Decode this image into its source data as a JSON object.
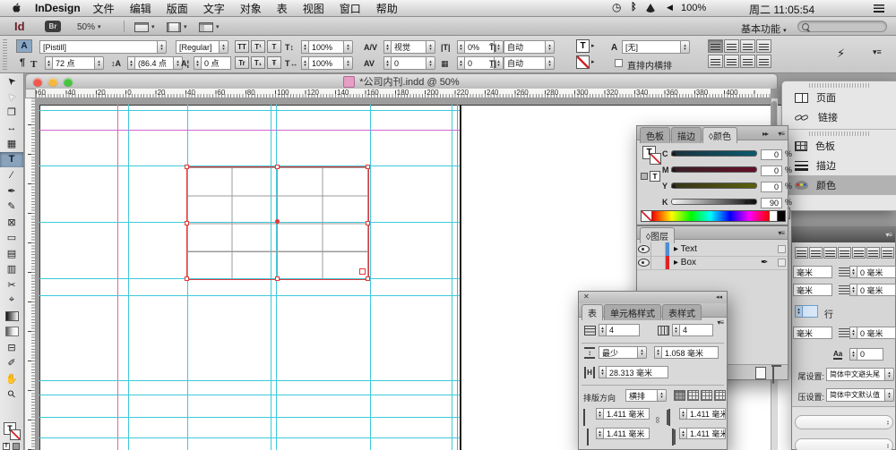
{
  "menubar": {
    "app_name": "InDesign",
    "menus": [
      "文件",
      "编辑",
      "版面",
      "文字",
      "对象",
      "表",
      "视图",
      "窗口",
      "帮助"
    ],
    "battery_level": "100%",
    "clock": "周二 11:05:54"
  },
  "appbar": {
    "app_logo": "Id",
    "bridge_label": "Br",
    "zoom_level": "50%",
    "workspace": "基本功能"
  },
  "controlbar": {
    "char_mode_label": "A",
    "para_mode_label": "¶",
    "font_family": "[Pistill]",
    "font_style": "[Regular]",
    "case_buttons": [
      "TT",
      "T¹",
      "T",
      "Tr",
      "T₁",
      "Ŧ"
    ],
    "font_size": "72 点",
    "leading": "(86.4 点",
    "baseline_shift": "0 点",
    "vertical_scale": "100%",
    "horizontal_scale": "100%",
    "kerning": "视觉",
    "tracking": "0",
    "proportional_spacing": "0%",
    "grid_jidori": "0",
    "grid_align_top": "自动",
    "grid_align_bottom": "自动",
    "char_style": "[无]",
    "tatechuyoko_label": "直排内横排"
  },
  "tools": [
    {
      "name": "selection-tool",
      "glyph": "➤",
      "rot": -135
    },
    {
      "name": "direct-selection-tool",
      "glyph": "➤",
      "rot": -135,
      "cls": "ghost"
    },
    {
      "name": "page-tool",
      "glyph": "❐"
    },
    {
      "name": "gap-tool",
      "glyph": "↔"
    },
    {
      "name": "content-collector-tool",
      "glyph": "▦"
    },
    {
      "name": "type-tool",
      "glyph": "T",
      "active": true
    },
    {
      "name": "line-tool",
      "glyph": "∕"
    },
    {
      "name": "pen-tool",
      "glyph": "✒"
    },
    {
      "name": "pencil-tool",
      "glyph": "✎"
    },
    {
      "name": "frame-tool",
      "glyph": "⊠"
    },
    {
      "name": "rectangle-tool",
      "glyph": "▭"
    },
    {
      "name": "horizontal-grid-tool",
      "glyph": "▤"
    },
    {
      "name": "vertical-grid-tool",
      "glyph": "▥"
    },
    {
      "name": "scissors-tool",
      "glyph": "✂"
    },
    {
      "name": "free-transform-tool",
      "glyph": "⌖"
    },
    {
      "name": "gradient-swatch-tool",
      "glyph": "",
      "cls": "g1"
    },
    {
      "name": "gradient-feather-tool",
      "glyph": "",
      "cls": "g2"
    },
    {
      "name": "note-tool",
      "glyph": "⊟"
    },
    {
      "name": "eyedropper-tool",
      "glyph": "✐"
    },
    {
      "name": "hand-tool",
      "glyph": "✋"
    },
    {
      "name": "zoom-tool",
      "glyph": "⚲",
      "rot": -45
    }
  ],
  "docwindow": {
    "title": "*公司内刊.indd @ 50%",
    "ruler_numbers": [
      "60",
      "40",
      "20",
      "0",
      "20",
      "40",
      "60",
      "80",
      "100",
      "120",
      "140",
      "160",
      "180",
      "200",
      "220",
      "240",
      "260",
      "280",
      "300",
      "320",
      "340",
      "360",
      "380",
      "400"
    ]
  },
  "canvas": {
    "guides_v_cyan": [
      143,
      209,
      302,
      308,
      413,
      504
    ],
    "guides_v_red": [
      131,
      510
    ],
    "guides_h_cyan": [
      123,
      185,
      248,
      311,
      330,
      425,
      441,
      466,
      489
    ],
    "guides_h_magenta": [
      145
    ],
    "cyan": "#3fc8da",
    "red": "#e26b86",
    "magenta": "#cf66cf"
  },
  "color_panel": {
    "tabs": [
      {
        "label": "色板"
      },
      {
        "label": "描边"
      },
      {
        "label": "◊颜色",
        "active": true
      }
    ],
    "sliders": [
      {
        "channel": "C",
        "value": "0",
        "track_from": "#1b323c",
        "track_to": "#0a5a70"
      },
      {
        "channel": "M",
        "value": "0",
        "track_from": "#382026",
        "track_to": "#64102a"
      },
      {
        "channel": "Y",
        "value": "0",
        "track_from": "#35331d",
        "track_to": "#5a600c"
      },
      {
        "channel": "K",
        "value": "90",
        "track_from": "#f4f4f4",
        "track_to": "#0a0a0a"
      }
    ],
    "unit": "%"
  },
  "layers_panel": {
    "tab": "◊图层",
    "layers": [
      {
        "name": "Text",
        "color": "#4d8ed2",
        "pen": false
      },
      {
        "name": "Box",
        "color": "#e02328",
        "pen": true
      }
    ]
  },
  "table_panel": {
    "tabs": [
      {
        "label": "表",
        "active": true
      },
      {
        "label": "单元格样式"
      },
      {
        "label": "表样式"
      }
    ],
    "body_rows": "4",
    "body_cols": "4",
    "row_height_mode": "最少",
    "row_height": "1.058 毫米",
    "column_width": "28.313 毫米",
    "direction_label": "排版方向",
    "direction": "横排",
    "inset_top": "1.411 毫米",
    "inset_bottom": "1.411 毫米",
    "inset_left": "1.411 毫米",
    "inset_right": "1.411 毫米"
  },
  "dock": {
    "groups": [
      {
        "items": [
          {
            "label": "页面",
            "icon": "pages"
          },
          {
            "label": "链接",
            "icon": "links"
          }
        ]
      },
      {
        "items": [
          {
            "label": "色板",
            "icon": "swatches"
          },
          {
            "label": "描边",
            "icon": "stroke"
          },
          {
            "label": "颜色",
            "icon": "color",
            "active": true
          }
        ]
      }
    ]
  },
  "paragraph_panel": {
    "fields": [
      {
        "unit": "毫米",
        "value": "0 毫米"
      },
      {
        "unit": "毫米",
        "value": "0 毫米"
      },
      {
        "unit": "毫米",
        "value": "0 毫米"
      }
    ],
    "grid_label": "行",
    "aa_value": "0",
    "kinsoku_label": "尾设置:",
    "kinsoku_value": "简体中文避头尾",
    "mojikumi_label": "压设置:",
    "mojikumi_value": "简体中文默认值"
  }
}
